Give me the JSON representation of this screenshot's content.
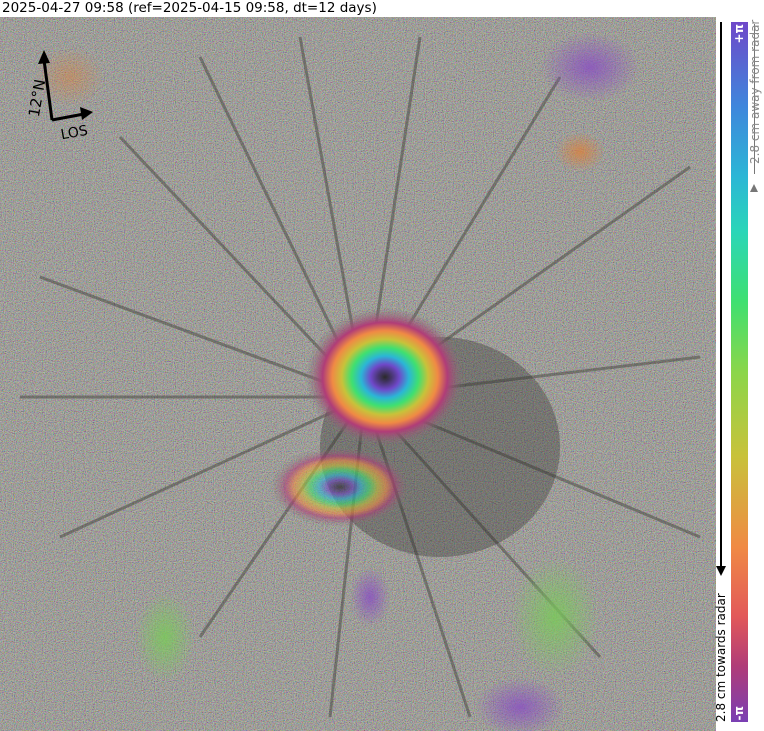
{
  "header": {
    "title": "2025-04-27 09:58 (ref=2025-04-15 09:58, dt=12 days)"
  },
  "compass": {
    "north_label": "12°N",
    "los_label": "LOS"
  },
  "colorbar": {
    "top_label": "+π",
    "bottom_label": "-π",
    "away_label": "2.8 cm away from radar",
    "towards_label": "2.8 cm towards radar",
    "colors": [
      "#7a3fb3",
      "#b03c78",
      "#e2585a",
      "#f08a44",
      "#c8c23a",
      "#8bd64a",
      "#3fe070",
      "#2ad6b8",
      "#2bb6d6",
      "#3f86dc",
      "#6f48c9"
    ]
  }
}
